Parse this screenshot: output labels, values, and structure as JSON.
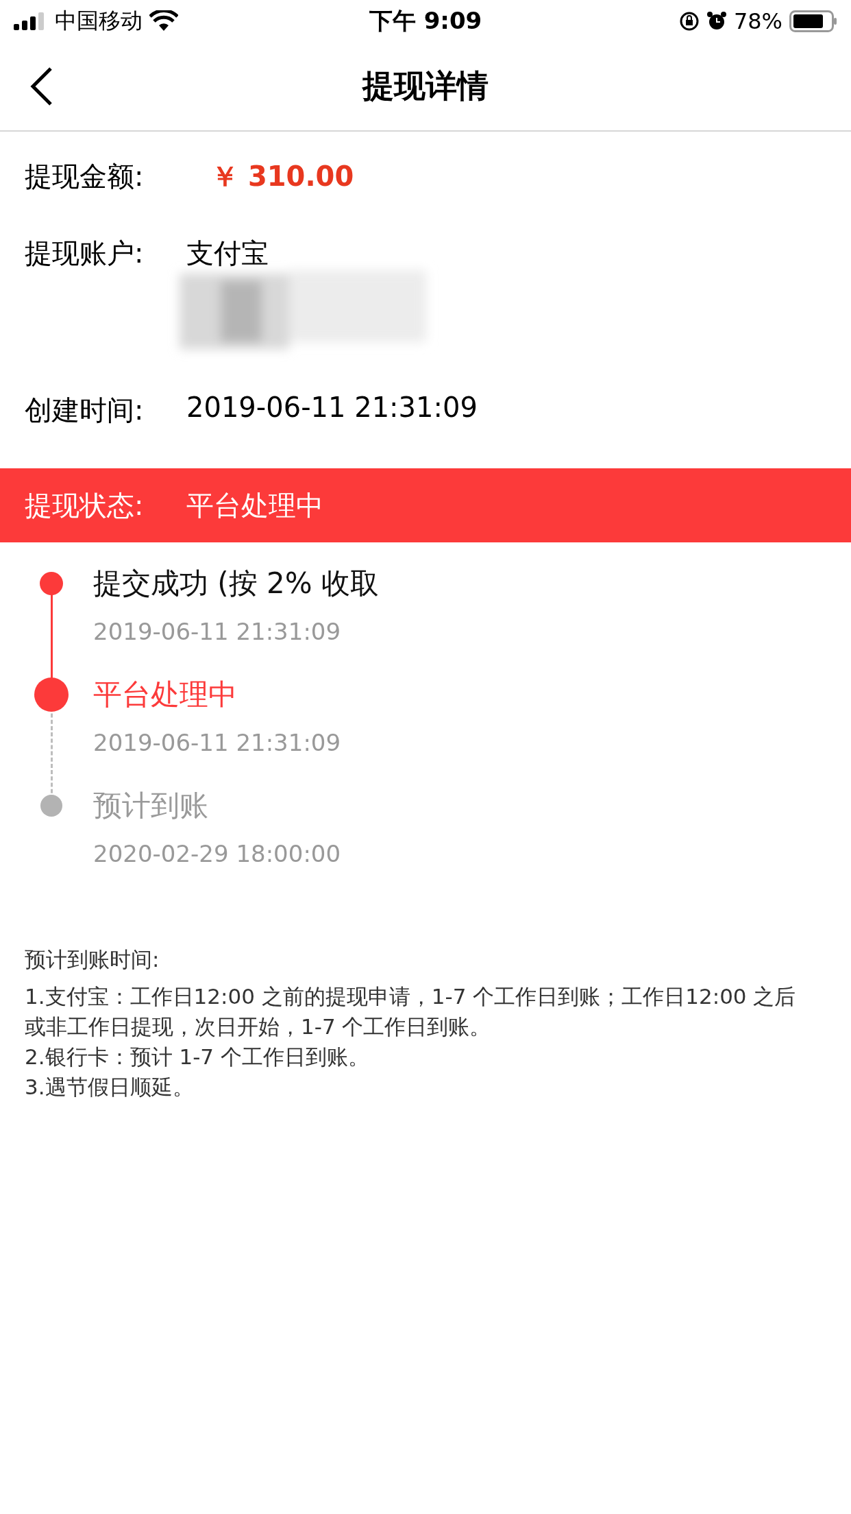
{
  "status_bar": {
    "carrier": "中国移动",
    "time": "下午 9:09",
    "battery": "78%"
  },
  "nav": {
    "title": "提现详情"
  },
  "details": [
    {
      "kind": "amount",
      "label": "提现金额:",
      "value": "￥ 310.00"
    },
    {
      "kind": "account",
      "label": "提现账户:",
      "value": "支付宝"
    },
    {
      "kind": "plain",
      "label": "创建时间:",
      "value": "2019-06-11 21:31:09"
    }
  ],
  "status_banner": {
    "label": "提现状态:",
    "value": "平台处理中"
  },
  "timeline": [
    {
      "kind": "done",
      "title": "提交成功 (按 2% 收取",
      "time": "2019-06-11 21:31:09"
    },
    {
      "kind": "current",
      "title": "平台处理中",
      "time": "2019-06-11 21:31:09"
    },
    {
      "kind": "pending",
      "title": "预计到账",
      "time": "2020-02-29 18:00:00"
    }
  ],
  "notes": {
    "title": "预计到账时间:",
    "lines": [
      "1.支付宝：工作日12:00 之前的提现申请，1-7 个工作日到账；工作日12:00 之后或非工作日提现，次日开始，1-7 个工作日到账。",
      "2.银行卡：预计 1-7 个工作日到账。",
      "3.遇节假日顺延。"
    ]
  }
}
